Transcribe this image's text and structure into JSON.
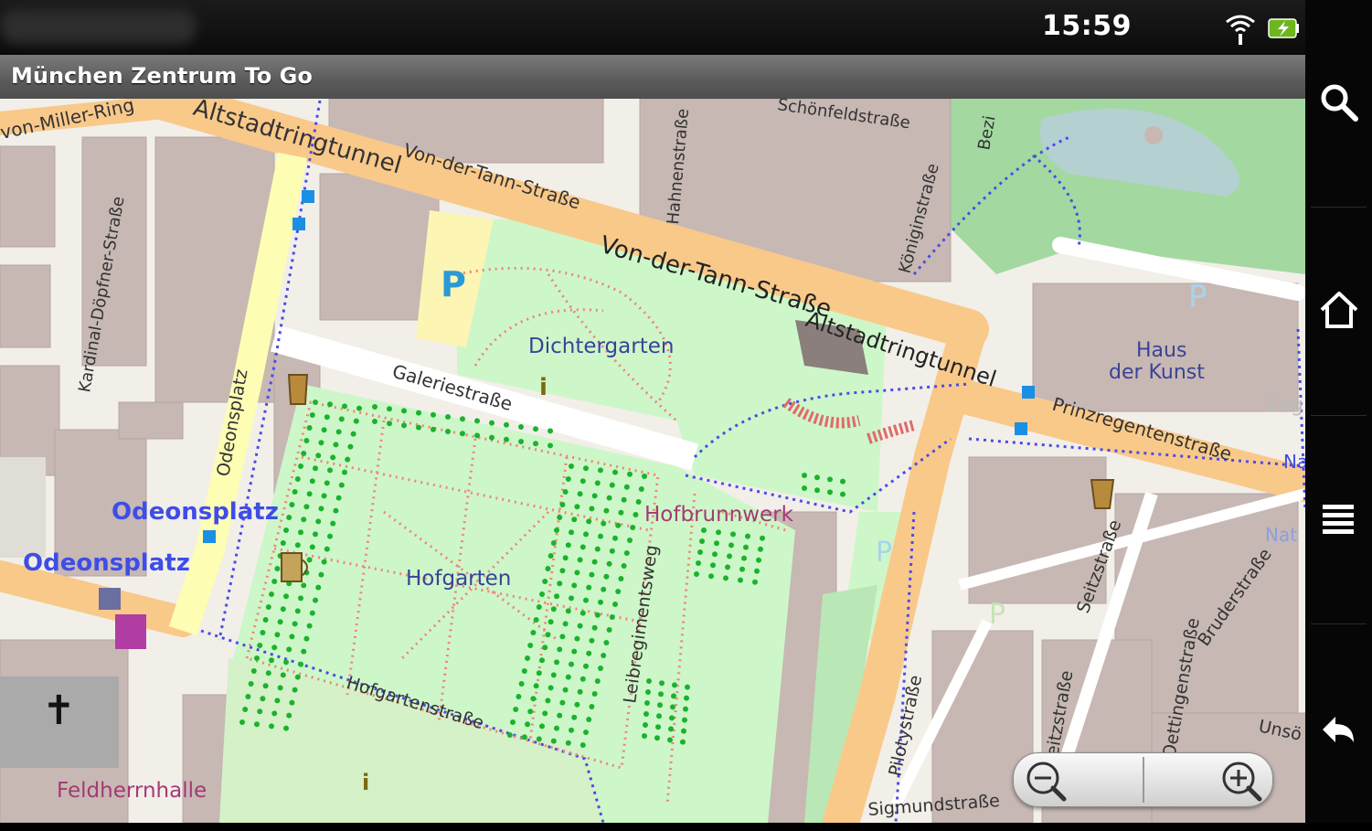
{
  "status_bar": {
    "time": "15:59",
    "icons": [
      "wifi-icon",
      "battery-icon"
    ]
  },
  "title_bar": {
    "title": "München Zentrum To Go"
  },
  "map": {
    "labels": {
      "von_miller_ring": "von-Miller-Ring",
      "altstadtringtunnel_top": "Altstadtringtunnel",
      "von_der_tann_small": "Von-der-Tann-Straße",
      "von_der_tann_big": "Von-der-Tann-Straße",
      "hahnenstrasse": "Hahnenstraße",
      "schoenfeldstrasse": "Schönfeldstraße",
      "koeniginstrasse": "Königinstraße",
      "bezirk": "Bezi",
      "kardinal": "Kardinal-Döpfner-Straße",
      "odeonsplatz_street": "Odeonsplatz",
      "odeonsplatz_1": "Odeonsplatz",
      "odeonsplatz_2": "Odeonsplatz",
      "dichtergarten": "Dichtergarten",
      "galeriestrasse": "Galeriestraße",
      "altstadtringtunnel_mid": "Altstadtringtunnel",
      "haus_der_kunst_1": "Haus",
      "haus_der_kunst_2": "der Kunst",
      "prinzregentenstrasse": "Prinzregentenstraße",
      "hofbrunnwerk": "Hofbrunnwerk",
      "hofgarten": "Hofgarten",
      "leibregimentsweg": "Leibregimentsweg",
      "hofgartenstrasse": "Hofgartenstraße",
      "feldherrnhalle": "Feldherrnhalle",
      "seitzstrasse": "Seitzstraße",
      "seitzstrasse_2": "Seitzstraße",
      "bruderstrasse": "Bruderstraße",
      "pilotystrasse": "Pilotystraße",
      "sigmundstrasse": "Sigmundstraße",
      "oettingenstrasse": "Oettingenstraße",
      "emp": "Eng",
      "na": "Na",
      "nat": "Nat",
      "unso": "Unsö",
      "parking": "P",
      "info": "i"
    }
  },
  "zoom": {
    "icons": [
      "zoom-out-icon",
      "zoom-in-icon"
    ]
  },
  "system_bar": {
    "icons": [
      "search-icon",
      "home-icon",
      "menu-icon",
      "back-icon"
    ]
  },
  "colors": {
    "road_primary": "#f9c98a",
    "road_secondary": "#fdfdb4",
    "park": "#cdf7c9",
    "forest": "#a3d9a1",
    "building": "#c7b8b4",
    "background": "#f2efe9",
    "footway": "#4a4ce8",
    "path": "#f0847a",
    "parking_blue": "#2a9ad6",
    "place_label": "#3f4de6",
    "poi_label": "#a43a73"
  }
}
